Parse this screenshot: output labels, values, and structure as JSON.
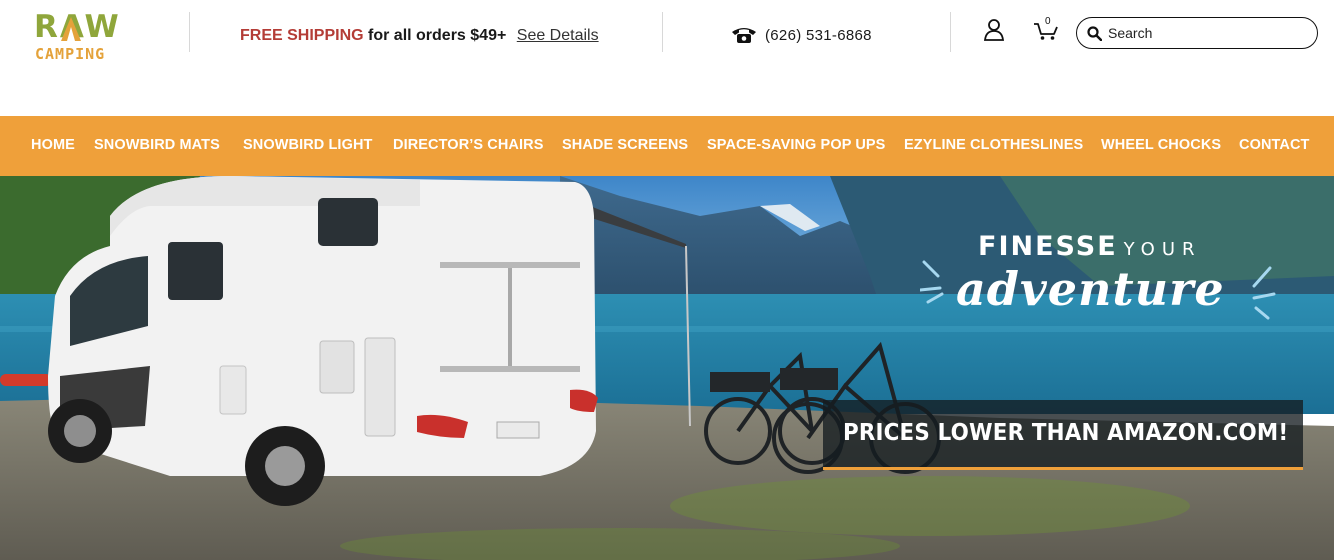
{
  "logo": {
    "line1": "RAW",
    "line2": "CAMPING"
  },
  "promo": {
    "highlight": "FREE SHIPPING",
    "text": " for all orders $49+",
    "link": "See Details"
  },
  "contact": {
    "phone": "(626) 531-6868",
    "icon": "phone-icon"
  },
  "cart": {
    "count": "0"
  },
  "search": {
    "placeholder": "Search"
  },
  "nav": {
    "items": [
      "HOME",
      "SNOWBIRD MATS",
      "SNOWBIRD LIGHT",
      "DIRECTOR’S CHAIRS",
      "SHADE SCREENS",
      "SPACE-SAVING POP UPS",
      "EZYLINE CLOTHESLINES",
      "WHEEL CHOCKS",
      "CONTACT"
    ]
  },
  "hero": {
    "tagline_bold": "FINESSE",
    "tagline_light": "YOUR",
    "tagline_script": "adventure",
    "banner": "PRICES LOWER THAN AMAZON.COM!"
  },
  "colors": {
    "accent_orange": "#efa03a",
    "logo_green": "#8fa63b",
    "promo_red": "#b43c36"
  }
}
